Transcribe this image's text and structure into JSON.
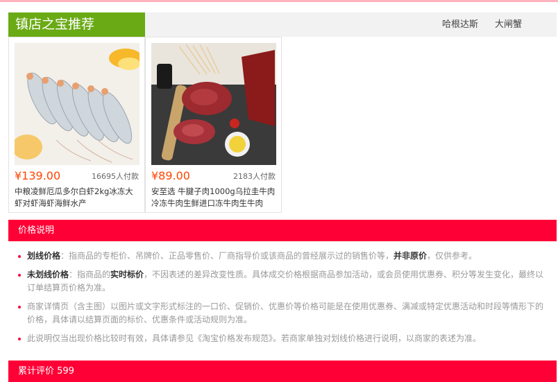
{
  "header": {
    "title": "镇店之宝推荐",
    "tabs": [
      "哈根达斯",
      "大闸蟹"
    ]
  },
  "products": [
    {
      "price": "¥139.00",
      "sold": "16695人付款",
      "title": "中粮凌鲜厄瓜多尔白虾2kg冰冻大虾对虾海虾海鲜水产",
      "image_icon": "shrimp-photo"
    },
    {
      "price": "¥89.00",
      "sold": "2183人付款",
      "title": "安至选 牛腱子肉1000g乌拉圭牛肉冷冻牛肉生鲜进口冻牛肉生牛肉",
      "image_icon": "beef-photo"
    }
  ],
  "price_info": {
    "title": "价格说明",
    "items": [
      {
        "term": "划线价格",
        "text_a": "：指商品的专柜价、吊牌价、正品零售价、厂商指导价或该商品的曾经展示过的销售价等，",
        "strong": "并非原价",
        "text_b": "，仅供参考。"
      },
      {
        "term": "未划线价格",
        "text_a": "：指商品的",
        "strong": "实时标价",
        "text_b": "，不因表述的差异改变性质。具体成交价格根据商品参加活动，或会员使用优惠券、积分等发生变化，最终以订单结算页价格为准。"
      },
      {
        "text": "商家详情页（含主图）以图片或文字形式标注的一口价、促销价、优惠价等价格可能是在使用优惠券、满减或特定优惠活动和时段等情形下的价格，具体请以结算页面的标价、优惠条件或活动规则为准。"
      },
      {
        "text": "此说明仅当出现价格比较时有效，具体请参见《淘宝价格发布规范》。若商家单独对划线价格进行说明，以商家的表述为准。"
      }
    ]
  },
  "reviews": {
    "title": "累计评价 599"
  },
  "colors": {
    "header_green": "#6aaa15",
    "accent_red": "#ff0036",
    "price_orange": "#ff4400"
  }
}
